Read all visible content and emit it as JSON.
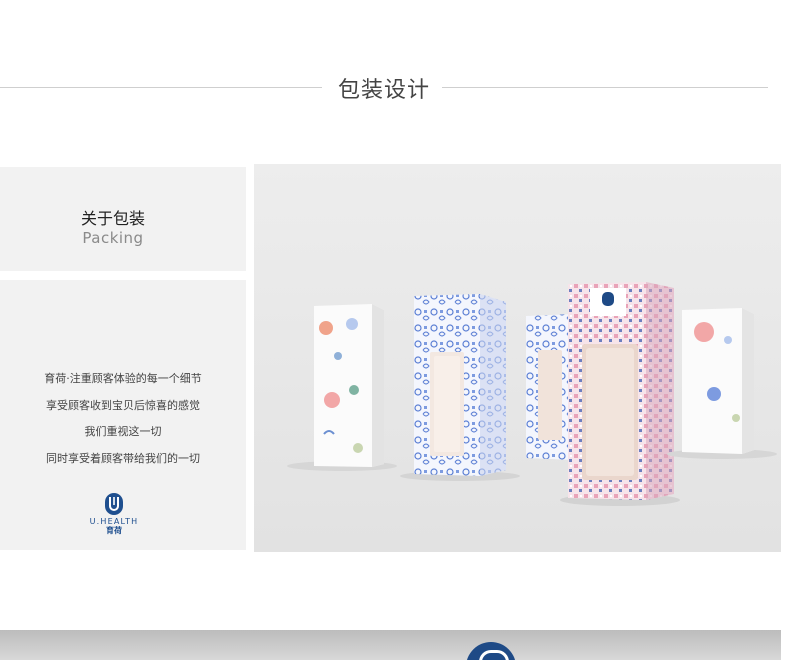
{
  "section": {
    "title": "包装设计"
  },
  "intro": {
    "title_zh": "关于包装",
    "title_en": "Packing"
  },
  "description": [
    "育荷·注重顾客体验的每一个细节",
    "享受顾客收到宝贝后惊喜的感觉",
    "我们重视这一切",
    "同时享受着顾客带给我们的一切"
  ],
  "logo": {
    "brand_en": "U.HEALTH",
    "brand_zh": "育荷",
    "icon": "u-health-logo-icon"
  },
  "colors": {
    "brand_blue": "#1e4a86",
    "pattern_blue": "#5b7fd4",
    "pattern_pink": "#e9a3b8"
  }
}
